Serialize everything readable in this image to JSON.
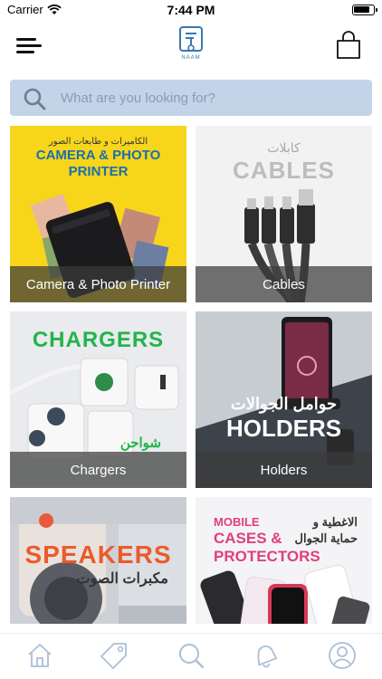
{
  "status_bar": {
    "carrier": "Carrier",
    "time": "7:44 PM",
    "battery_level": 0.85
  },
  "header": {
    "menu_icon": "hamburger-menu-icon",
    "logo_text": "NAAM",
    "cart_icon": "shopping-bag-icon"
  },
  "search": {
    "placeholder": "What are you looking for?",
    "value": ""
  },
  "categories": [
    {
      "label": "Camera & Photo Printer",
      "banner_en": "CAMERA & PHOTO",
      "banner_en_2": "PRINTER",
      "banner_ar": "الكاميرات و طابعات الصور",
      "color": "#f7d51b"
    },
    {
      "label": "Cables",
      "banner_en": "CABLES",
      "banner_ar": "كابلات",
      "color": "#f2f2f2"
    },
    {
      "label": "Chargers",
      "banner_en": "CHARGERS",
      "banner_ar": "شواحن",
      "color": "#e9ebee"
    },
    {
      "label": "Holders",
      "banner_en": "HOLDERS",
      "banner_ar": "حوامل الجوالات",
      "color": "#5d6770"
    },
    {
      "label": "",
      "banner_en": "SPEAKERS",
      "banner_ar": "مكبرات الصوت",
      "color": "#dbdee2"
    },
    {
      "label": "",
      "banner_en": "MOBILE",
      "banner_en_2": "CASES &",
      "banner_en_3": "PROTECTORS",
      "banner_ar": "الاغطية و",
      "banner_ar_2": "حماية الجوال",
      "color": "#f4f4f6"
    }
  ],
  "tab_bar": {
    "tabs": [
      "home-icon",
      "tag-icon",
      "search-icon",
      "notification-bell-icon",
      "profile-icon"
    ],
    "active_color": "#a9bfd8"
  }
}
